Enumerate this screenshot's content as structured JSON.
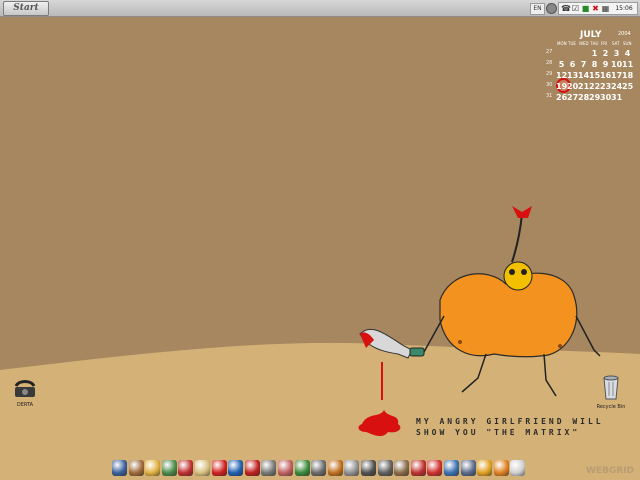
{
  "topbar": {
    "start_label": "Start",
    "language": "EN",
    "clock": "15:06"
  },
  "calendar": {
    "month": "JULY",
    "year": "2004",
    "weekdays": [
      "MON",
      "TUE",
      "WED",
      "THU",
      "FRI",
      "SAT",
      "SUN"
    ],
    "week_numbers": [
      "27",
      "28",
      "29",
      "30",
      "31"
    ],
    "weeks": [
      [
        "",
        "",
        "",
        "1",
        "2",
        "3",
        "4"
      ],
      [
        "5",
        "6",
        "7",
        "8",
        "9",
        "10",
        "11"
      ],
      [
        "12",
        "13",
        "14",
        "15",
        "16",
        "17",
        "18"
      ],
      [
        "19",
        "20",
        "21",
        "22",
        "23",
        "24",
        "25"
      ],
      [
        "26",
        "27",
        "28",
        "29",
        "30",
        "31",
        ""
      ]
    ],
    "today": "19",
    "colors": {
      "text": "#ffffff",
      "today_ring": "#d01010"
    }
  },
  "desktop": {
    "icons": [
      {
        "name": "phone-icon",
        "label": "DERTA"
      },
      {
        "name": "recycle-bin-icon",
        "label": "Recycle Bin"
      }
    ],
    "quote_line1": "MY ANGRY GIRLFRIEND WILL",
    "quote_line2": "SHOW YOU \"THE MATRIX\"",
    "watermark": "WEBGRID"
  },
  "tray_icons": [
    "phone-icon",
    "checkbox-icon",
    "green-icon",
    "close-icon",
    "network-icon"
  ],
  "dock": {
    "items": [
      {
        "name": "monitor-icon",
        "color": "#3a5f9a"
      },
      {
        "name": "burner-icon",
        "color": "#a06a3a"
      },
      {
        "name": "beer-icon",
        "color": "#e0b040"
      },
      {
        "name": "trash-icon",
        "color": "#4a8a4a"
      },
      {
        "name": "mailbox-icon",
        "color": "#c03030"
      },
      {
        "name": "rabbit-icon",
        "color": "#d8c080"
      },
      {
        "name": "opera-icon",
        "color": "#d02020"
      },
      {
        "name": "m-icon",
        "color": "#2060b0"
      },
      {
        "name": "forbidden-icon",
        "color": "#c02020"
      },
      {
        "name": "skull-icon",
        "color": "#777777"
      },
      {
        "name": "notebook-icon",
        "color": "#c06060"
      },
      {
        "name": "eye-icon",
        "color": "#3a8a3a"
      },
      {
        "name": "target-icon",
        "color": "#6a6a6a"
      },
      {
        "name": "winamp-icon",
        "color": "#c07020"
      },
      {
        "name": "glass-icon",
        "color": "#909090"
      },
      {
        "name": "ant-icon",
        "color": "#505050"
      },
      {
        "name": "camera-icon",
        "color": "#606060"
      },
      {
        "name": "box-icon",
        "color": "#8a6a4a"
      },
      {
        "name": "books-icon",
        "color": "#c03030"
      },
      {
        "name": "lifebuoy-icon",
        "color": "#d03030"
      },
      {
        "name": "globe-icon",
        "color": "#3a70b0"
      },
      {
        "name": "photo-icon",
        "color": "#5a6a8a"
      },
      {
        "name": "warning-icon",
        "color": "#e0a020"
      },
      {
        "name": "q-icon",
        "color": "#e08020"
      },
      {
        "name": "clock-icon",
        "color": "#d0d0d0"
      }
    ]
  }
}
